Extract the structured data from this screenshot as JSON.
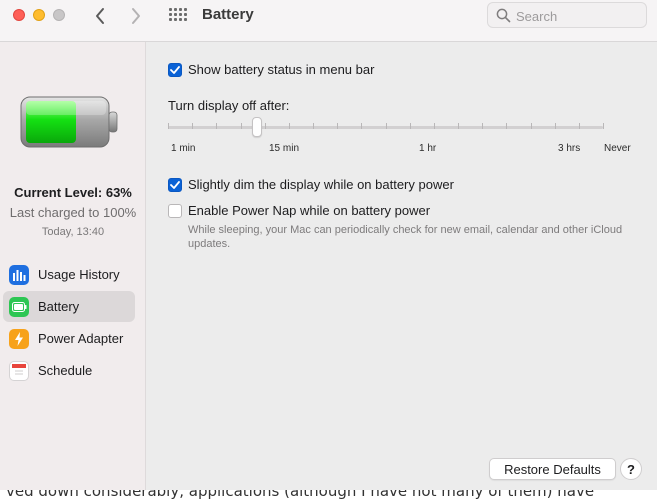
{
  "window": {
    "title": "Battery",
    "search_placeholder": "Search"
  },
  "sidebar": {
    "current_level": "Current Level: 63%",
    "last_charged": "Last charged to 100%",
    "charged_time": "Today, 13:40",
    "battery_level_fraction": 0.63,
    "items": [
      {
        "label": "Usage History",
        "icon": "bar-chart-icon",
        "color": "#1f6fe0",
        "active": false
      },
      {
        "label": "Battery",
        "icon": "battery-icon",
        "color": "#2dc653",
        "active": true
      },
      {
        "label": "Power Adapter",
        "icon": "lightning-icon",
        "color": "#f7a21b",
        "active": false
      },
      {
        "label": "Schedule",
        "icon": "calendar-icon",
        "color": "#e8453c",
        "active": false
      }
    ]
  },
  "main": {
    "show_status": {
      "label": "Show battery status in menu bar",
      "checked": true
    },
    "display_off": {
      "title": "Turn display off after:",
      "tick_labels": [
        "1 min",
        "15 min",
        "1 hr",
        "3 hrs",
        "Never"
      ],
      "selected": "15 min"
    },
    "dim_display": {
      "label": "Slightly dim the display while on battery power",
      "checked": true
    },
    "power_nap": {
      "label": "Enable Power Nap while on battery power",
      "checked": false,
      "description": "While sleeping, your Mac can periodically check for new email, calendar and other iCloud updates."
    },
    "restore_label": "Restore Defaults",
    "help_label": "?"
  },
  "background": {
    "text": "ved down considerably, applications (although I have not many of them) have"
  }
}
